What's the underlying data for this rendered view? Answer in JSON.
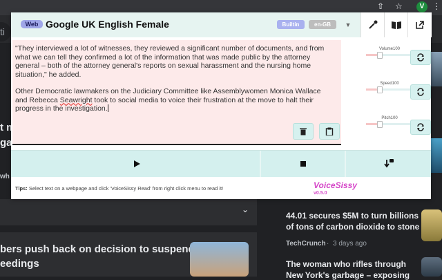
{
  "browser": {
    "avatar_initial": "V",
    "omnibox_partial": "ti"
  },
  "background_page": {
    "left_fragment_1": "t m",
    "left_fragment_2": "ga",
    "left_fragment_3": "wh",
    "headline_1_line1": "bers push back on decision to suspend",
    "headline_1_line2": "eedings",
    "story_1_line1": "44.01 secures $5M to turn billions",
    "story_1_line2": "of tons of carbon dioxide to stone",
    "story_1_source": "TechCrunch",
    "story_1_time": "3 days ago",
    "story_2_line1": "The woman who rifles through",
    "story_2_line2": "New York's garbage – exposing"
  },
  "popup": {
    "web_badge": "Web",
    "voice_name": "Google UK English Female",
    "builtin_badge": "Builtin",
    "lang_badge": "en-GB",
    "text_paragraph_1_a": "\"They interviewed a lot of witnesses, they reviewed a significant number of documents, and from what we can tell they confirmed a lot of the information that was made public by the attorney general – both of the attorney general's reports on sexual harassment and the nursing home situation,\" he added.",
    "text_paragraph_2_a": "Other Democratic lawmakers on the Judiciary Committee like Assemblywomen Monica Wallace and Rebecca ",
    "text_paragraph_2_misspelled": "Seawright",
    "text_paragraph_2_b": " took to social media to voice their frustration at the move to halt their progress in the investigation.",
    "sliders": [
      {
        "label": "Volume100",
        "value": 0.3
      },
      {
        "label": "Speed100",
        "value": 0.3
      },
      {
        "label": "Pitch100",
        "value": 0.3
      }
    ],
    "tips_label": "Tips:",
    "tips_text": " Select text on a webpage and click 'VoiceSissy Read' from right click menu to read it!",
    "brand": "VoiceSissy",
    "version": "v0.5.0"
  },
  "colors": {
    "accent_teal": "#d4f0ee",
    "text_bg": "#fdeaea",
    "brand_pink": "#d546c8"
  }
}
